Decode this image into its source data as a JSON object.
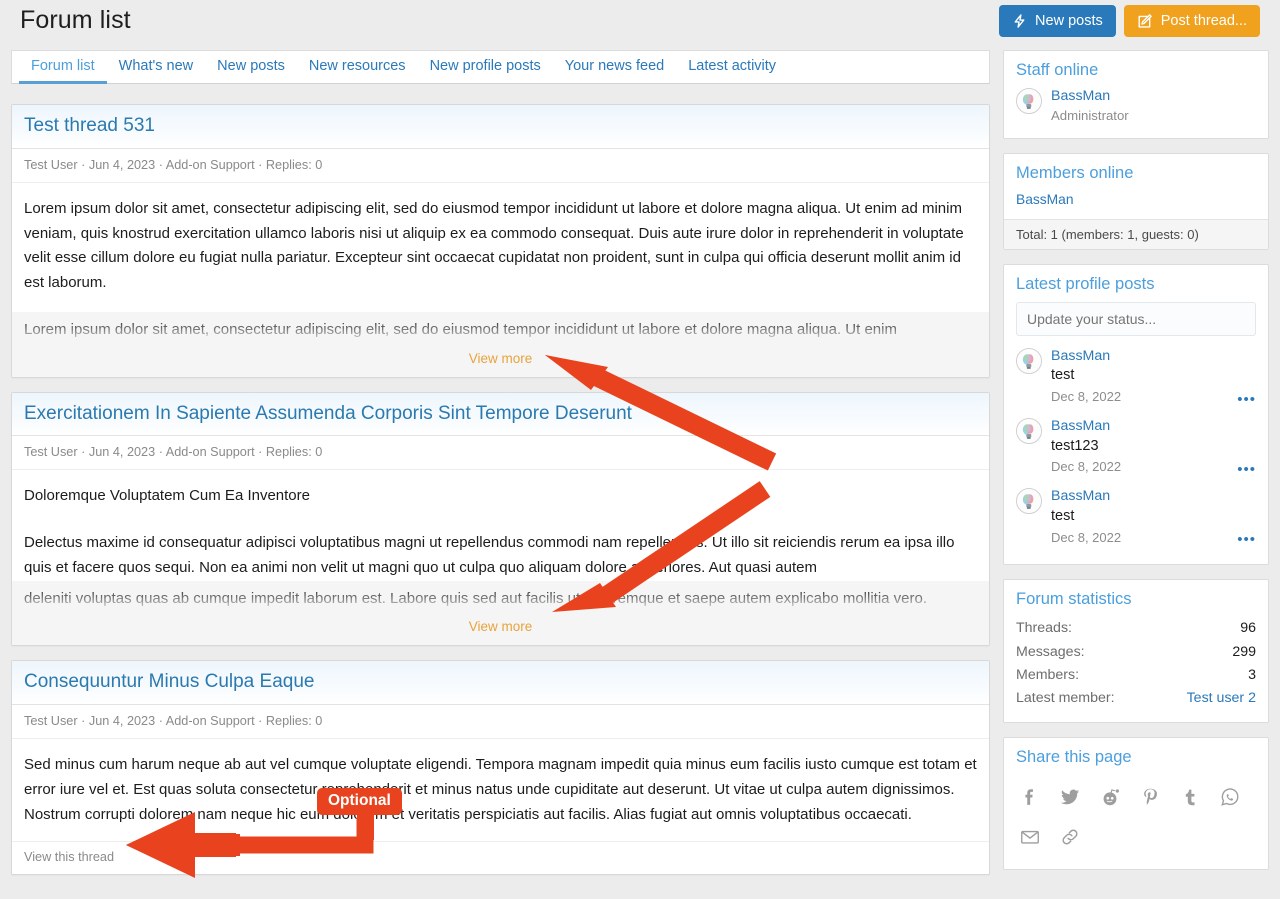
{
  "header": {
    "title": "Forum list",
    "buttons": [
      {
        "label": "New posts",
        "icon": "lightning-icon",
        "color": "#2a79ba"
      },
      {
        "label": "Post thread...",
        "icon": "compose-icon",
        "color": "#f0a11e"
      }
    ]
  },
  "tabs": [
    {
      "label": "Forum list",
      "active": true
    },
    {
      "label": "What's new",
      "active": false
    },
    {
      "label": "New posts",
      "active": false
    },
    {
      "label": "New resources",
      "active": false
    },
    {
      "label": "New profile posts",
      "active": false
    },
    {
      "label": "Your news feed",
      "active": false
    },
    {
      "label": "Latest activity",
      "active": false
    }
  ],
  "threads": [
    {
      "title": "Test thread 531",
      "meta": "Test User · Jun 4, 2023 · Add-on Support · Replies: 0",
      "author": "Test User",
      "date": "Jun 4, 2023",
      "forum": "Add-on Support",
      "replies": "Replies: 0",
      "body": "Lorem ipsum dolor sit amet, consectetur adipiscing elit, sed do eiusmod tempor incididunt ut labore et dolore magna aliqua. Ut enim ad minim veniam, quis knostrud exercitation ullamco laboris nisi ut aliquip ex ea commodo consequat. Duis aute irure dolor in reprehenderit in voluptate velit esse cillum dolore eu fugiat nulla pariatur. Excepteur sint occaecat cupidatat non proident, sunt in culpa qui officia deserunt mollit anim id est laborum.",
      "truncated": "Lorem ipsum dolor sit amet, consectetur adipiscing elit, sed do eiusmod tempor incididunt ut labore et dolore magna aliqua. Ut enim",
      "view_more": "View more"
    },
    {
      "title": "Exercitationem In Sapiente Assumenda Corporis Sint Tempore Deserunt",
      "meta": "Test User · Jun 4, 2023 · Add-on Support · Replies: 0",
      "author": "Test User",
      "date": "Jun 4, 2023",
      "forum": "Add-on Support",
      "replies": "Replies: 0",
      "subheading": "Doloremque Voluptatem Cum Ea Inventore",
      "body": "Delectus maxime id consequatur adipisci voluptatibus magni ut repellendus commodi nam repellendus. Ut illo sit reiciendis rerum ea ipsa illo quis et facere quos sequi. Non ea animi non velit ut magni quo ut culpa quo aliquam dolore asperiores. Aut quasi autem",
      "truncated": "deleniti voluptas quas ab cumque impedit laborum est. Labore quis sed aut facilis ut doloremque et saepe autem explicabo mollitia vero.",
      "view_more": "View more"
    },
    {
      "title": "Consequuntur Minus Culpa Eaque",
      "meta": "Test User · Jun 4, 2023 · Add-on Support · Replies: 0",
      "author": "Test User",
      "date": "Jun 4, 2023",
      "forum": "Add-on Support",
      "replies": "Replies: 0",
      "body": "Sed minus cum harum neque ab aut vel cumque voluptate eligendi. Tempora magnam impedit quia minus eum facilis iusto cumque est totam et error iure vel et. Est quas soluta consectetur reprehenderit et minus natus unde cupiditate aut deserunt. Ut vitae ut culpa autem dignissimos. Nostrum corrupti dolorem nam neque hic eum dolorem et veritatis perspiciatis aut facilis. Alias fugiat aut omnis voluptatibus occaecati.",
      "footer_link": "View this thread"
    }
  ],
  "sidebar": {
    "staff_online": {
      "title": "Staff online",
      "members": [
        {
          "name": "BassMan",
          "role": "Administrator",
          "avatar": "lightbulb-avatar"
        }
      ]
    },
    "members_online": {
      "title": "Members online",
      "members": [
        {
          "name": "BassMan"
        }
      ],
      "total": "Total: 1 (members: 1, guests: 0)"
    },
    "latest_profile_posts": {
      "title": "Latest profile posts",
      "status_placeholder": "Update your status...",
      "posts": [
        {
          "name": "BassMan",
          "text": "test",
          "date": "Dec 8, 2022",
          "menu": "•••"
        },
        {
          "name": "BassMan",
          "text": "test123",
          "date": "Dec 8, 2022",
          "menu": "•••"
        },
        {
          "name": "BassMan",
          "text": "test",
          "date": "Dec 8, 2022",
          "menu": "•••"
        }
      ]
    },
    "forum_statistics": {
      "title": "Forum statistics",
      "rows": [
        {
          "key": "Threads:",
          "value": "96",
          "link": false
        },
        {
          "key": "Messages:",
          "value": "299",
          "link": false
        },
        {
          "key": "Members:",
          "value": "3",
          "link": false
        },
        {
          "key": "Latest member:",
          "value": "Test user 2",
          "link": true
        }
      ]
    },
    "share_this_page": {
      "title": "Share this page",
      "icons": [
        "facebook-icon",
        "twitter-icon",
        "reddit-icon",
        "pinterest-icon",
        "tumblr-icon",
        "whatsapp-icon",
        "email-icon",
        "link-icon"
      ]
    }
  },
  "annotations": {
    "optional_label": "Optional",
    "arrow_color": "#e8431e"
  }
}
